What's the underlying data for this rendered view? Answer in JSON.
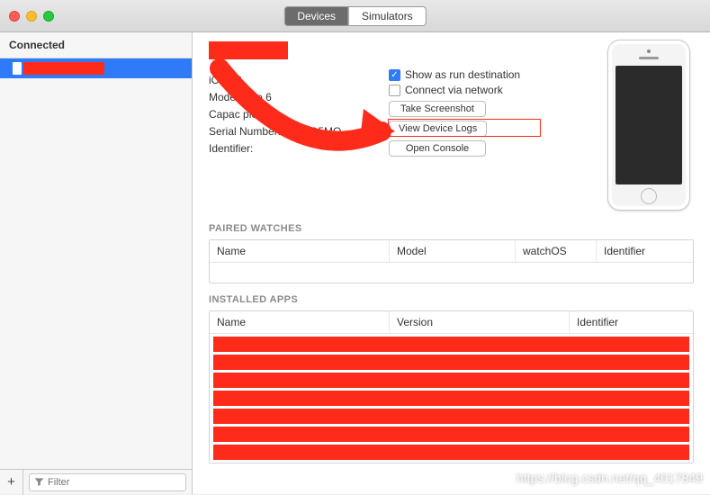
{
  "titlebar": {
    "devices_label": "Devices",
    "simulators_label": "Simulators"
  },
  "sidebar": {
    "header": "Connected",
    "device_name": "",
    "filter_placeholder": "Filter"
  },
  "device_info": {
    "os_line": "iOS 12",
    "model_line": "Model: iP      e 6",
    "capacity_line": "Capac                                          ple)",
    "serial_line": "Serial Number: F1        WG5MQ",
    "identifier_line": "Identifier:"
  },
  "controls": {
    "show_run": "Show as run destination",
    "connect_net": "Connect via network",
    "take_screenshot": "Take Screenshot",
    "view_logs": "View Device Logs",
    "open_console": "Open Console"
  },
  "watches": {
    "title": "PAIRED WATCHES",
    "cols": [
      "Name",
      "Model",
      "watchOS",
      "Identifier"
    ]
  },
  "apps": {
    "title": "INSTALLED APPS",
    "cols": [
      "Name",
      "Version",
      "Identifier"
    ]
  },
  "watermark": "https://blog.csdn.net/qq_4017849"
}
